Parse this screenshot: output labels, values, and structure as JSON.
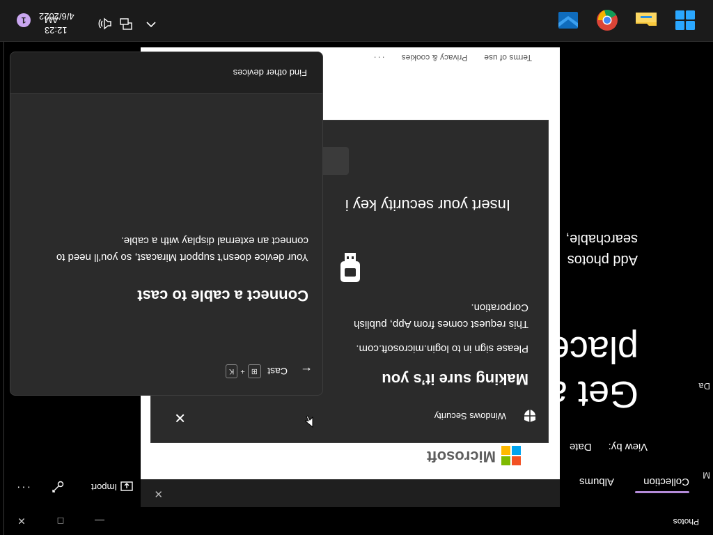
{
  "photos": {
    "title": "Photos",
    "minimize": "—",
    "maximize": "□",
    "close": "✕",
    "tabs": [
      {
        "label": "Collection"
      },
      {
        "label": "Albums"
      }
    ],
    "import_label": "Import",
    "more": "···",
    "view_by_label": "View by:",
    "view_by_value": "Date",
    "heading": "Get a\nplace",
    "subtext": "Add photos\nsearchable,",
    "sidebar_date": "Da",
    "sidebar_m": "M",
    "accent_color": "#b48bd9"
  },
  "browser": {
    "close": "✕",
    "brand": "Microsoft",
    "footer": {
      "terms": "Terms of use",
      "privacy": "Privacy & cookies",
      "more": "···"
    }
  },
  "security": {
    "title": "Windows Security",
    "close": "✕",
    "heading": "Making sure it’s you",
    "msg1": "Please sign in to login.microsoft.com.",
    "msg2": "This request comes from App, publish\nCorporation.",
    "insert": "Insert your security key i"
  },
  "cast": {
    "back": "←",
    "title": "Cast",
    "shortcut_key1": "⊞",
    "shortcut_plus": "+",
    "shortcut_key2": "K",
    "heading": "Connect a cable to cast",
    "body": "Your device doesn’t support Miracast, so you’ll need to connect an external display with a cable.",
    "find_other": "Find other devices"
  },
  "taskbar": {
    "apps": [
      "start-icon",
      "file-explorer-icon",
      "chrome-icon",
      "mail-icon"
    ],
    "time": "12:23 AM",
    "date": "4/6/2022",
    "notification_count": "1"
  }
}
